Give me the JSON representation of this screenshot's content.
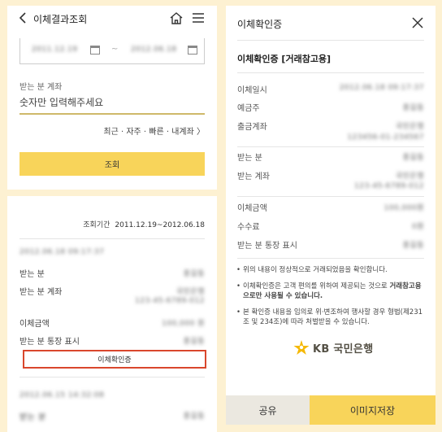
{
  "colors": {
    "background": "#fdf1d2",
    "accent_yellow": "#f8d45a",
    "highlight_red": "#d9472d",
    "input_underline": "#cfb96a",
    "share_button_bg": "#ebe8e0"
  },
  "left": {
    "header": {
      "title": "이체결과조회",
      "icons": [
        "back-icon",
        "home-icon",
        "menu-icon"
      ]
    },
    "date_range": {
      "start": "2011.12.19",
      "end": "2012.06.18"
    },
    "account": {
      "label": "받는 분 계좌",
      "placeholder": "숫자만 입력해주세요"
    },
    "quick_links": "최근 · 자주 · 빠른 · 내계좌 〉",
    "query_button": "조회",
    "results": {
      "period_label": "조회기간",
      "period_value": "2011.12.19~2012.06.18",
      "first": {
        "datetime": "2012.06.18 09:17:37",
        "recipient_label": "받는 분",
        "recipient_value": "홍길동",
        "account_label": "받는 분 계좌",
        "bank": "국민은행",
        "account_number": "123-45-6789-012",
        "amount_label": "이체금액",
        "amount_value": "100,000 원",
        "display_label": "받는 분 통장 표시",
        "display_value": "홍길동",
        "cert_button": "이체확인증"
      },
      "second": {
        "datetime": "2012.06.15 14:32:08",
        "recipient_value": "홍길동"
      }
    }
  },
  "right": {
    "header": {
      "title": "이체확인증",
      "icons": [
        "close-icon"
      ]
    },
    "cert_title": "이체확인증 [거래참고용]",
    "rows": [
      {
        "label": "이체일시",
        "value": "2012.06.18 09:17:37"
      },
      {
        "label": "예금주",
        "value": "홍길동"
      },
      {
        "label": "출금계좌",
        "value": "국민은행",
        "value2": "123456-01-234567"
      },
      {
        "label": "받는 분",
        "value": "홍길동"
      },
      {
        "label": "받는 계좌",
        "value": "국민은행",
        "value2": "123-45-6789-012"
      },
      {
        "label": "이체금액",
        "value": "100,000원"
      },
      {
        "label": "수수료",
        "value": "0원"
      },
      {
        "label": "받는 분 통장 표시",
        "value": "홍길동"
      }
    ],
    "notes": {
      "n1": "위의 내용이 정상적으로 거래되었음을 확인합니다.",
      "n2_pre": "이체확인증은 고객 편의를 위하여 제공되는 것으로 ",
      "n2_bold": "거래참고용으로만 사용될 수 있습니다.",
      "n3": "본 확인증 내용을 임의로 위·변조하여 행사할 경우 형법(제231조 및 234조)에 따라 처벌받을 수 있습니다."
    },
    "logo_text": "KB 국민은행",
    "share_button": "공유",
    "save_button": "이미지저장"
  }
}
